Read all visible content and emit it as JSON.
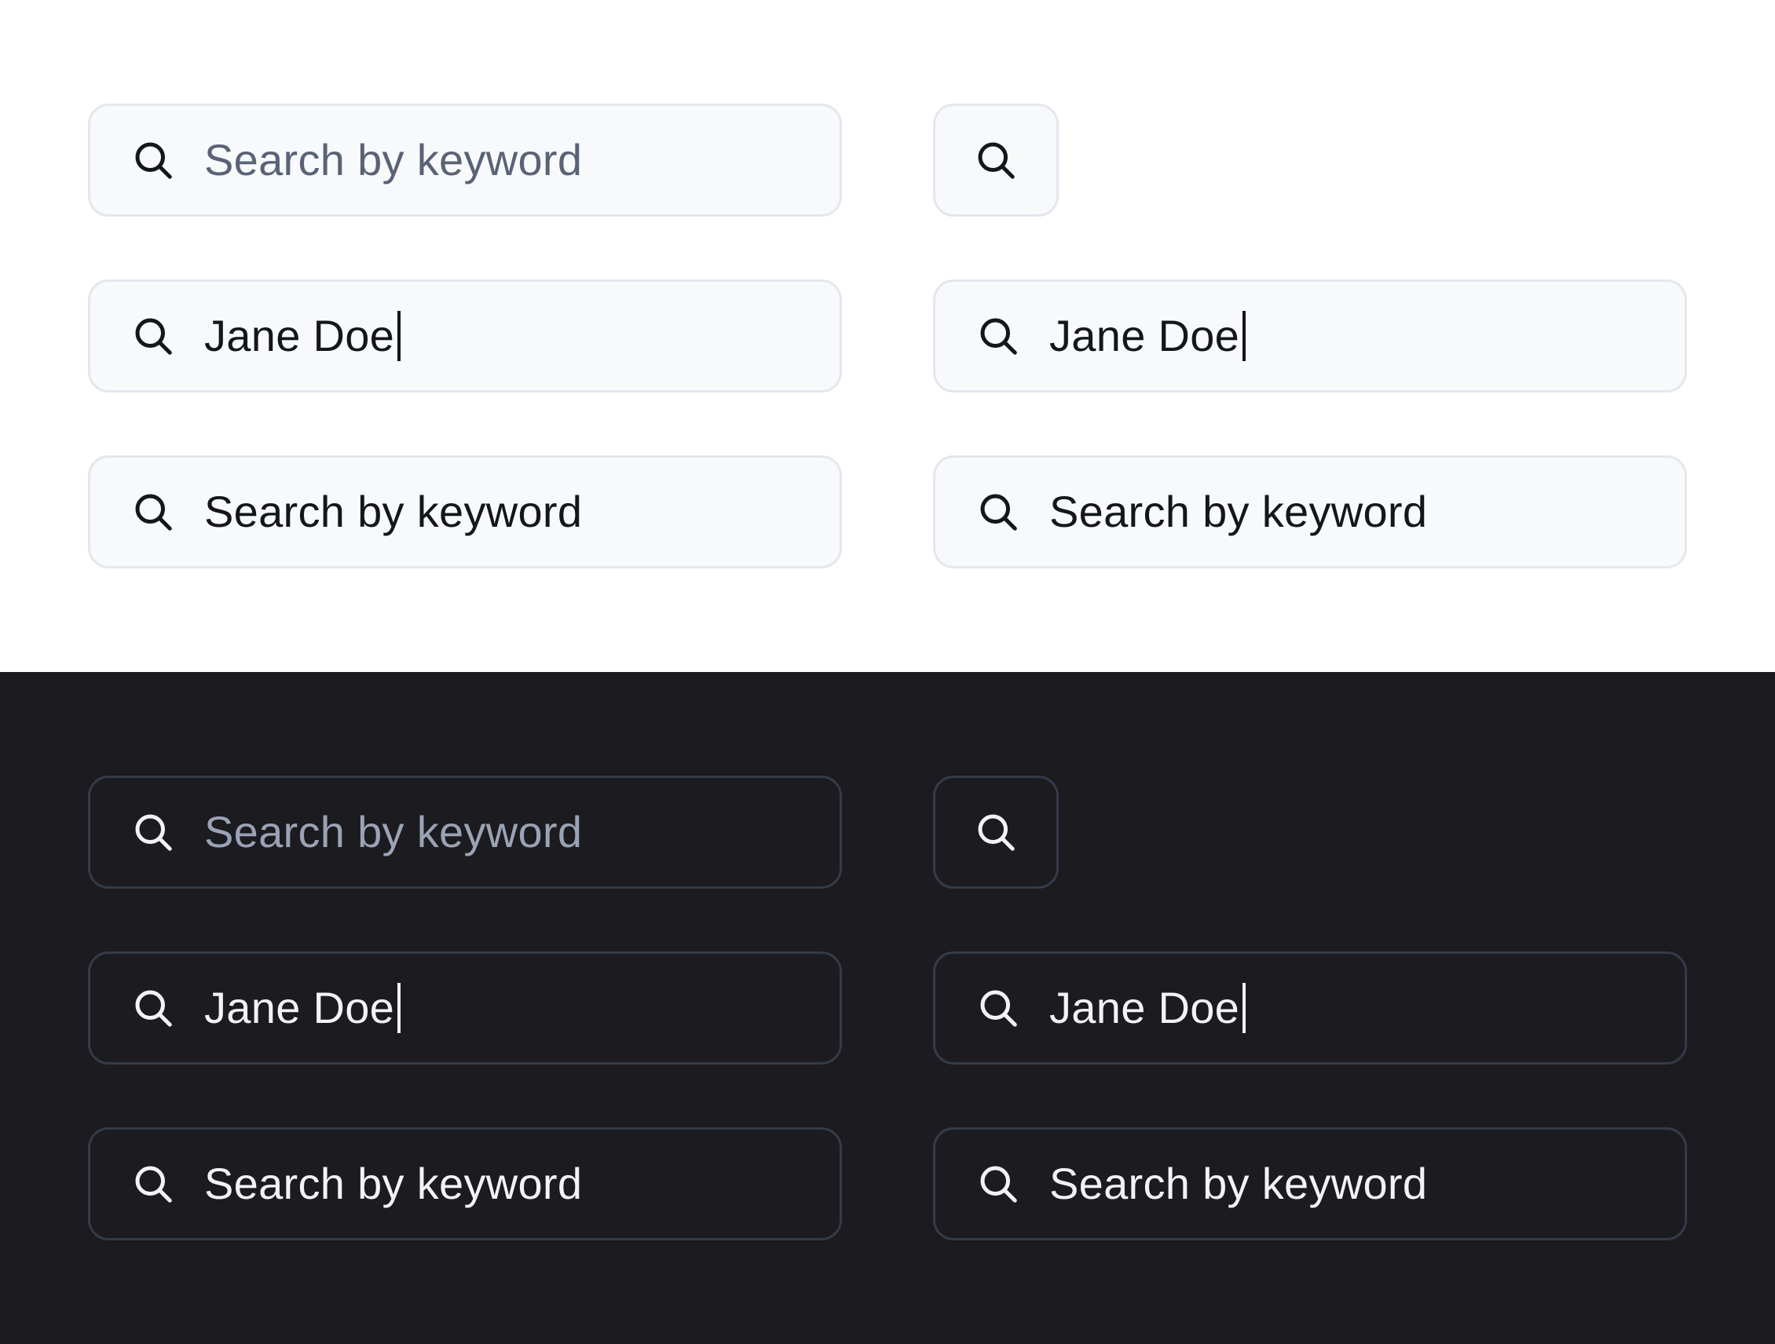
{
  "colors": {
    "light_background": "#ffffff",
    "light_field_background": "#f8f9fb",
    "light_field_border": "#e4e7ee",
    "light_text": "#14161c",
    "light_placeholder": "#5a6275",
    "dark_background": "#1b1b20",
    "dark_field_border": "#353b48",
    "dark_text": "#f2f3f6",
    "dark_placeholder": "#9aa3b4"
  },
  "icons": {
    "search": "search-icon"
  },
  "light": {
    "default_placeholder": "Search by keyword",
    "typing_value": "Jane Doe",
    "typing_value_right": "Jane Doe",
    "filled_value": "Search by keyword",
    "filled_value_right": "Search by keyword"
  },
  "dark": {
    "default_placeholder": "Search by keyword",
    "typing_value": "Jane Doe",
    "typing_value_right": "Jane Doe",
    "filled_value": "Search by keyword",
    "filled_value_right": "Search by keyword"
  }
}
